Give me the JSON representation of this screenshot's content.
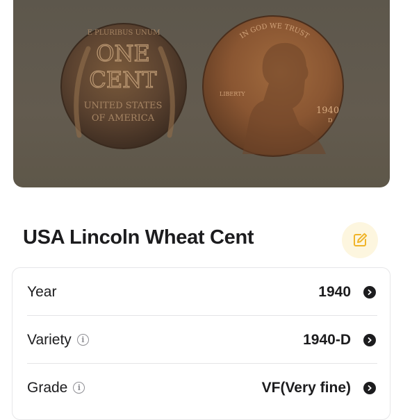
{
  "coin": {
    "name": "USA Lincoln Wheat Cent",
    "photo_alt": "",
    "reverse_text": {
      "top": "E PLURIBUS UNUM",
      "line1": "ONE",
      "line2": "CENT",
      "line3": "UNITED STATES",
      "line4": "OF AMERICA"
    },
    "obverse_text": {
      "motto": "IN GOD WE TRUST",
      "liberty": "LIBERTY",
      "year": "1940",
      "mint": "D"
    }
  },
  "actions": {
    "edit_icon": "edit-icon"
  },
  "details": [
    {
      "label": "Year",
      "value": "1940",
      "has_info": false
    },
    {
      "label": "Variety",
      "value": "1940-D",
      "has_info": true
    },
    {
      "label": "Grade",
      "value": "VF(Very fine)",
      "has_info": true
    }
  ],
  "colors": {
    "accent": "#f0b429",
    "accent_bg": "#fdf6df",
    "text": "#1c1c1e",
    "muted": "#8e8e93"
  }
}
